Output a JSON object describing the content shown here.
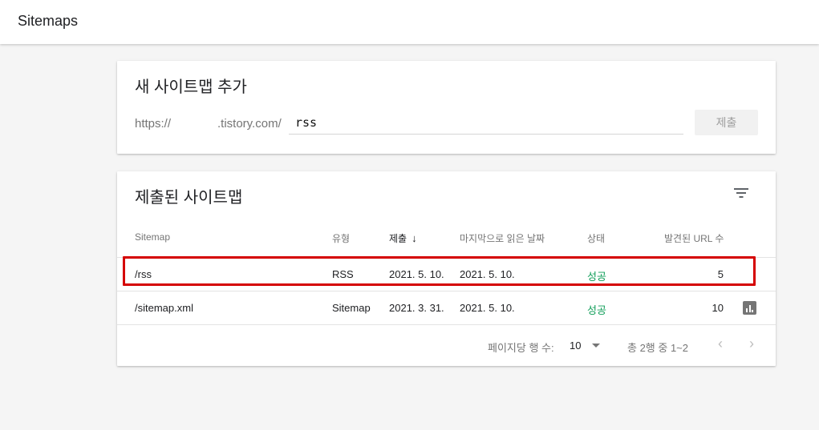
{
  "header": {
    "title": "Sitemaps"
  },
  "add_card": {
    "title": "새 사이트맵 추가",
    "url_prefix_a": "https://",
    "url_prefix_b": ".tistory.com/",
    "input_value": "rss",
    "submit_label": "제출"
  },
  "list_card": {
    "title": "제출된 사이트맵",
    "filter_icon": "filter-list-icon",
    "columns": [
      "Sitemap",
      "유형",
      "제출",
      "마지막으로 읽은 날짜",
      "상태",
      "발견된 URL 수"
    ],
    "sorted_column_arrow": "↓",
    "rows": [
      {
        "sitemap": "/rss",
        "type": "RSS",
        "submitted": "2021. 5. 10.",
        "last_read": "2021. 5. 10.",
        "status": "성공",
        "urls": "5"
      },
      {
        "sitemap": "/sitemap.xml",
        "type": "Sitemap",
        "submitted": "2021. 3. 31.",
        "last_read": "2021. 5. 10.",
        "status": "성공",
        "urls": "10"
      }
    ],
    "pager": {
      "rows_per_page_label": "페이지당 행 수:",
      "rows_per_page_value": "10",
      "range_text": "총 2행 중 1~2",
      "prev_icon": "‹",
      "next_icon": "›"
    }
  },
  "colors": {
    "status_success": "#0f9d58",
    "highlight": "#d50000"
  }
}
